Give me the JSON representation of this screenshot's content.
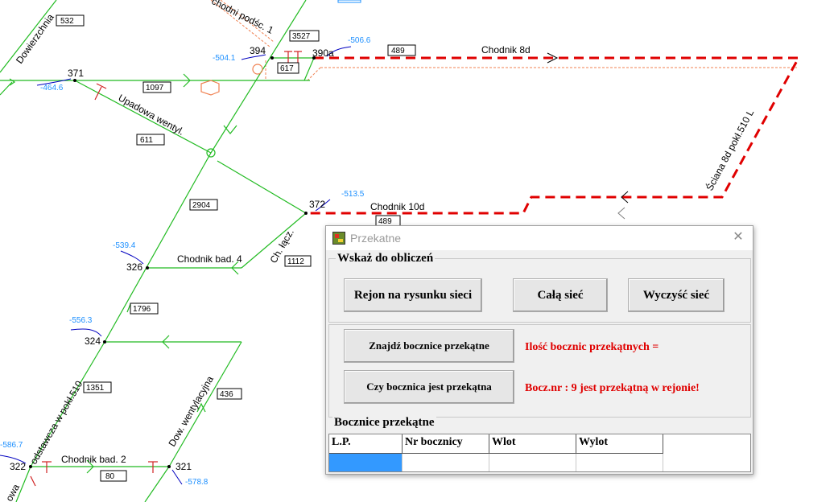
{
  "network": {
    "length_labels": [
      "532",
      "3527",
      "617",
      "489",
      "1097",
      "611",
      "2904",
      "489",
      "1112",
      "1796",
      "1351",
      "436",
      "80"
    ],
    "node_labels": [
      "371",
      "394",
      "390a",
      "372",
      "326",
      "324",
      "322",
      "321"
    ],
    "road_labels": [
      "Dowierzchnia",
      "chodni podśc. 1",
      "Chodnik 8d",
      "Upadowa wentyl.",
      "Ściana 8d pokł.510 L",
      "Chodnik 10d",
      "Chodnik bad. 4",
      "Ch. łącz.",
      "odstawcza w pokł.510",
      "Dow. wentylacyjna",
      "Chodnik bad. 2",
      "owa"
    ],
    "pressure_labels": [
      "-464.6",
      "-504.1",
      "-506.6",
      "-513.5",
      "-539.4",
      "-556.3",
      "-586.7",
      "-578.8"
    ],
    "colors": {
      "airway": "#22bb22",
      "diagonal": "#e00000",
      "pressure": "#1e90ff",
      "planned": "#f08050"
    }
  },
  "dialog": {
    "title": "Przekatne",
    "close_icon": "close-icon",
    "group_select": {
      "title": "Wskaż do obliczeń",
      "btn_region": "Rejon na rysunku sieci",
      "btn_all": "Całą sieć",
      "btn_clear": "Wyczyść sieć"
    },
    "btn_find": "Znajdź bocznice przekątne",
    "btn_check": "Czy bocznica jest przekątna",
    "msg_count": "Ilość bocznic przekątnych =",
    "msg_result": "Bocz.nr : 9 jest przekątną w rejonie!",
    "table": {
      "title": "Bocznice przekątne",
      "columns": [
        "L.P.",
        "Nr bocznicy",
        "Wlot",
        "Wylot"
      ]
    }
  }
}
